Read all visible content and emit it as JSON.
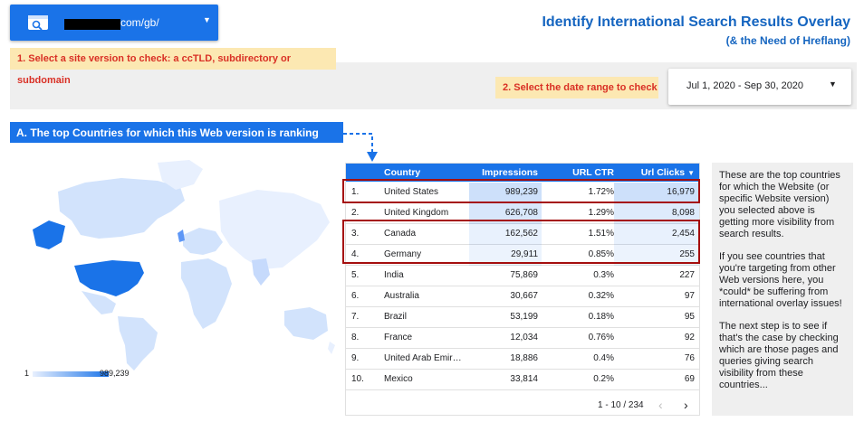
{
  "site_selector": {
    "value": "com/gb/",
    "icon": "search-console-icon"
  },
  "title": {
    "main": "Identify International Search Results Overlay",
    "sub": "(& the Need of Hreflang)"
  },
  "step1": "1. Select a site version to check: a ccTLD, subdirectory or subdomain",
  "step2": "2. Select the date range to check",
  "date_range": {
    "value": "Jul 1, 2020 - Sep 30, 2020"
  },
  "section_a": "A. The top Countries for which this Web version is ranking",
  "map_legend": {
    "min": "1",
    "max": "989,239"
  },
  "table": {
    "columns": [
      "Country",
      "Impressions",
      "URL CTR",
      "Url Clicks"
    ],
    "rows": [
      {
        "rank": "1.",
        "country": "United States",
        "impressions": "989,239",
        "ctr": "1.72%",
        "clicks": "16,979",
        "imp_level": 1.0,
        "clicks_level": 1.0
      },
      {
        "rank": "2.",
        "country": "United Kingdom",
        "impressions": "626,708",
        "ctr": "1.29%",
        "clicks": "8,098",
        "imp_level": 0.63,
        "clicks_level": 0.48
      },
      {
        "rank": "3.",
        "country": "Canada",
        "impressions": "162,562",
        "ctr": "1.51%",
        "clicks": "2,454",
        "imp_level": 0.16,
        "clicks_level": 0.14
      },
      {
        "rank": "4.",
        "country": "Germany",
        "impressions": "29,911",
        "ctr": "0.85%",
        "clicks": "255",
        "imp_level": 0.03,
        "clicks_level": 0.015
      },
      {
        "rank": "5.",
        "country": "India",
        "impressions": "75,869",
        "ctr": "0.3%",
        "clicks": "227",
        "imp_level": 0.0,
        "clicks_level": 0.0
      },
      {
        "rank": "6.",
        "country": "Australia",
        "impressions": "30,667",
        "ctr": "0.32%",
        "clicks": "97",
        "imp_level": 0.0,
        "clicks_level": 0.0
      },
      {
        "rank": "7.",
        "country": "Brazil",
        "impressions": "53,199",
        "ctr": "0.18%",
        "clicks": "95",
        "imp_level": 0.0,
        "clicks_level": 0.0
      },
      {
        "rank": "8.",
        "country": "France",
        "impressions": "12,034",
        "ctr": "0.76%",
        "clicks": "92",
        "imp_level": 0.0,
        "clicks_level": 0.0
      },
      {
        "rank": "9.",
        "country": "United Arab Emirat...",
        "impressions": "18,886",
        "ctr": "0.4%",
        "clicks": "76",
        "imp_level": 0.0,
        "clicks_level": 0.0
      },
      {
        "rank": "10.",
        "country": "Mexico",
        "impressions": "33,814",
        "ctr": "0.2%",
        "clicks": "69",
        "imp_level": 0.0,
        "clicks_level": 0.0
      }
    ],
    "pagination": "1 - 10 / 234"
  },
  "explanation": [
    "These are the top countries for which the Website (or specific Website version) you selected above is getting more visibility from search results.",
    "If you see countries that you're targeting from other Web versions here, you *could* be suffering from international overlay issues!",
    "The next step is to see if that's the case by checking which are those pages and queries giving search visibility from these countries..."
  ],
  "colors": {
    "accent": "#1a73e8",
    "title": "#1565c0",
    "note_bg": "#fce8b2",
    "note_text": "#d93025",
    "highlight": "#a50e0e",
    "panel_bg": "#efefef"
  }
}
